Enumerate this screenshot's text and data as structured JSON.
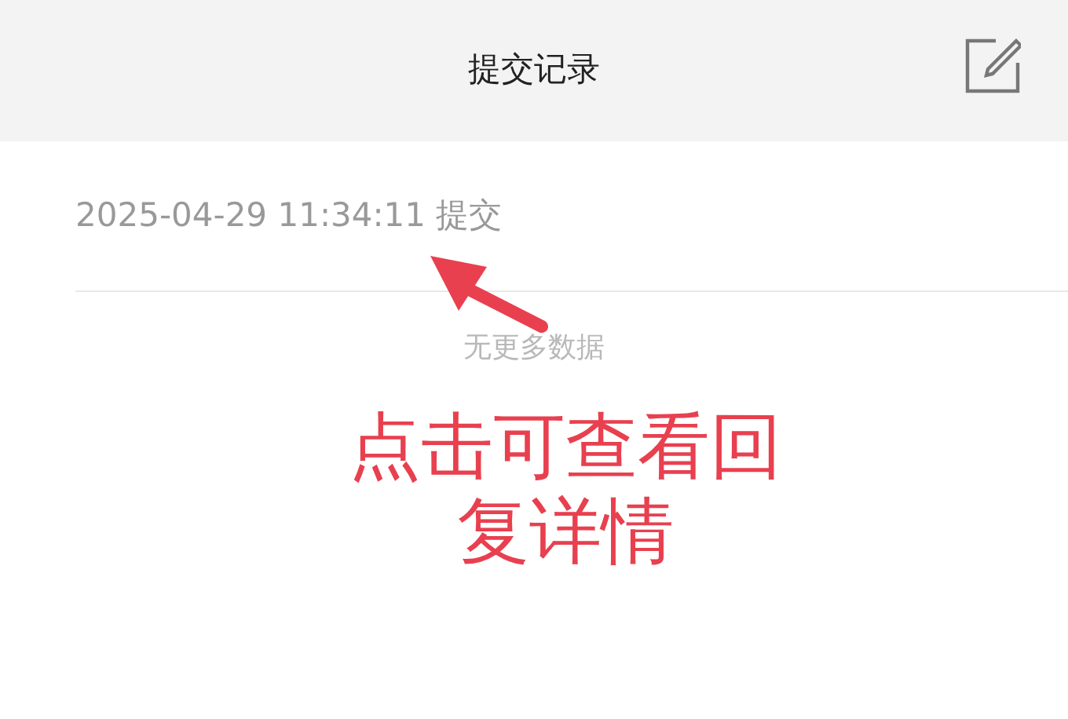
{
  "header": {
    "title": "提交记录"
  },
  "records": [
    {
      "text": "2025-04-29 11:34:11 提交"
    }
  ],
  "empty_text": "无更多数据",
  "annotation": {
    "text": "点击可查看回复详情"
  }
}
